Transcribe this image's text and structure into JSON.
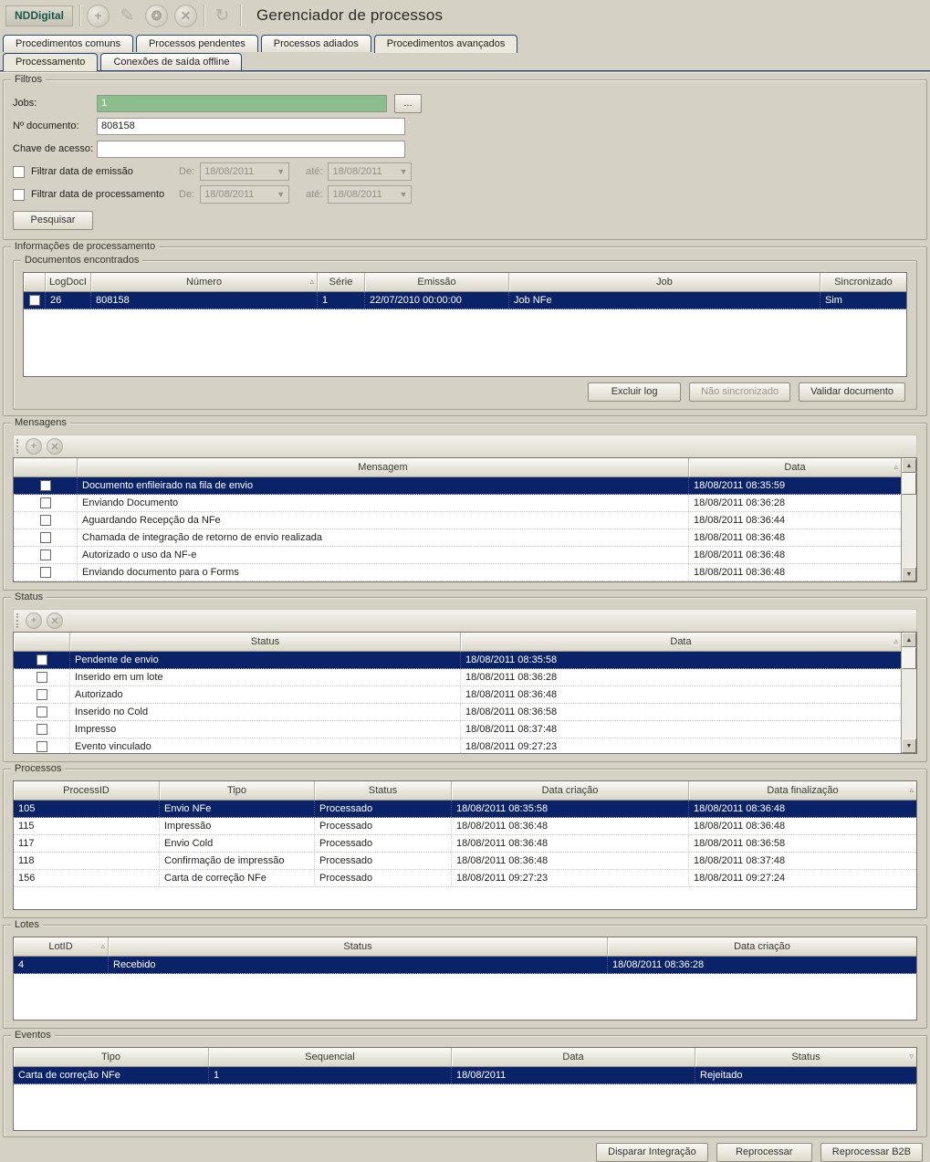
{
  "app": {
    "brand": "NDDigital",
    "title": "Gerenciador de processos"
  },
  "icons": {
    "plus": "+",
    "pencil": "✎",
    "gear": "❂",
    "close": "✕",
    "reprocess": "↻",
    "dropdown": "▼",
    "sort_asc": "▵",
    "sort_desc": "▿",
    "scroll_up": "▲",
    "scroll_down": "▼",
    "grip": ""
  },
  "tabs": {
    "main": [
      {
        "label": "Procedimentos comuns"
      },
      {
        "label": "Processos pendentes"
      },
      {
        "label": "Processos adiados"
      },
      {
        "label": "Procedimentos avançados"
      }
    ],
    "sub": [
      {
        "label": "Processamento"
      },
      {
        "label": "Conexões de saída offline"
      }
    ]
  },
  "filters": {
    "group": "Filtros",
    "jobs_label": "Jobs:",
    "jobs_value": "1",
    "browse": "...",
    "doc_label": "Nº documento:",
    "doc_value": "808158",
    "key_label": "Chave de acesso:",
    "key_value": "",
    "emission_label": "Filtrar data de emissão",
    "processing_label": "Filtrar data de processamento",
    "from_label": "De:",
    "to_label": "até:",
    "emission_from": "18/08/2011",
    "emission_to": "18/08/2011",
    "processing_from": "18/08/2011",
    "processing_to": "18/08/2011",
    "search": "Pesquisar"
  },
  "info": {
    "group": "Informações de processamento"
  },
  "documents": {
    "group": "Documentos encontrados",
    "columns": [
      "LogDocI",
      "Número",
      "Série",
      "Emissão",
      "Job",
      "Sincronizado"
    ],
    "rows": [
      [
        "26",
        "808158",
        "1",
        "22/07/2010 00:00:00",
        "Job NFe",
        "Sim"
      ]
    ],
    "buttons": [
      "Excluir log",
      "Não sincronizado",
      "Validar documento"
    ]
  },
  "messages": {
    "group": "Mensagens",
    "columns": [
      "Mensagem",
      "Data"
    ],
    "rows": [
      [
        "Documento enfileirado na fila de envio",
        "18/08/2011 08:35:59"
      ],
      [
        "Enviando Documento",
        "18/08/2011 08:36:28"
      ],
      [
        "Aguardando Recepção da NFe",
        "18/08/2011 08:36:44"
      ],
      [
        "Chamada de integração de retorno de envio realizada",
        "18/08/2011 08:36:48"
      ],
      [
        "Autorizado o uso da NF-e",
        "18/08/2011 08:36:48"
      ],
      [
        "Enviando documento para o Forms",
        "18/08/2011 08:36:48"
      ]
    ]
  },
  "status": {
    "group": "Status",
    "columns": [
      "Status",
      "Data"
    ],
    "rows": [
      [
        "Pendente de envio",
        "18/08/2011 08:35:58"
      ],
      [
        "Inserido em um lote",
        "18/08/2011 08:36:28"
      ],
      [
        "Autorizado",
        "18/08/2011 08:36:48"
      ],
      [
        "Inserido no Cold",
        "18/08/2011 08:36:58"
      ],
      [
        "Impresso",
        "18/08/2011 08:37:48"
      ],
      [
        "Evento vinculado",
        "18/08/2011 09:27:23"
      ]
    ]
  },
  "processes": {
    "group": "Processos",
    "columns": [
      "ProcessID",
      "Tipo",
      "Status",
      "Data criação",
      "Data finalização"
    ],
    "rows": [
      [
        "105",
        "Envio NFe",
        "Processado",
        "18/08/2011 08:35:58",
        "18/08/2011 08:36:48"
      ],
      [
        "115",
        "Impressão",
        "Processado",
        "18/08/2011 08:36:48",
        "18/08/2011 08:36:48"
      ],
      [
        "117",
        "Envio Cold",
        "Processado",
        "18/08/2011 08:36:48",
        "18/08/2011 08:36:58"
      ],
      [
        "118",
        "Confirmação de impressão",
        "Processado",
        "18/08/2011 08:36:48",
        "18/08/2011 08:37:48"
      ],
      [
        "156",
        "Carta de correção NFe",
        "Processado",
        "18/08/2011 09:27:23",
        "18/08/2011 09:27:24"
      ]
    ]
  },
  "lots": {
    "group": "Lotes",
    "columns": [
      "LotID",
      "Status",
      "Data criação"
    ],
    "rows": [
      [
        "4",
        "Recebido",
        "18/08/2011 08:36:28"
      ]
    ]
  },
  "events": {
    "group": "Eventos",
    "columns": [
      "Tipo",
      "Sequencial",
      "Data",
      "Status"
    ],
    "rows": [
      [
        "Carta de correção NFe",
        "1",
        "18/08/2011",
        "Rejeitado"
      ]
    ]
  },
  "footer": {
    "buttons": [
      "Disparar Integração",
      "Reprocessar",
      "Reprocessar B2B"
    ]
  },
  "colors": {
    "selection": "#0a2368",
    "jobs_field": "#8cbd8c",
    "brand_text": "#14584a"
  }
}
